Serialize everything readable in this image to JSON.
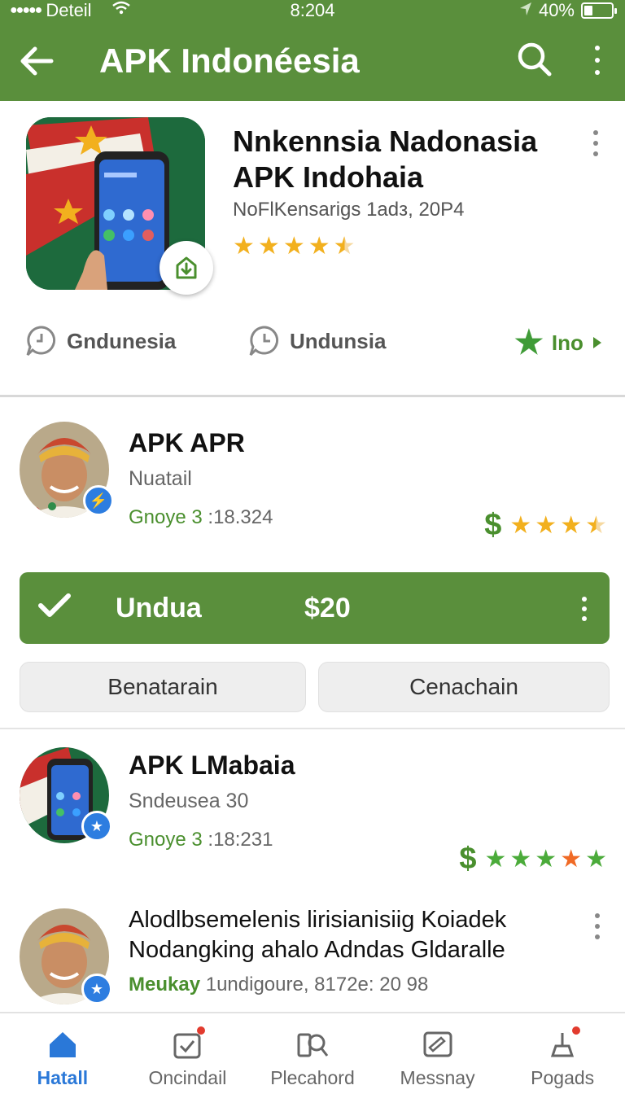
{
  "status_bar": {
    "dots": "●●●●●",
    "carrier": "Deteil",
    "time": "8:204",
    "battery": "40%"
  },
  "app_bar": {
    "title": "APK  Indonéesia"
  },
  "hero": {
    "title": "Nnkennsia Nadonasia APK Indohaia",
    "subtitle": "NoFlKensarigs 1adз, 20P4",
    "rating_stars": 4.5,
    "actions": [
      {
        "label": "Gndunesia"
      },
      {
        "label": "Undunsia"
      },
      {
        "label": "Ino"
      }
    ]
  },
  "items": [
    {
      "title": "APK APR",
      "subtitle": "Nuatail",
      "meta_green": "Gnoye 3",
      "meta_rest": " :18.324",
      "dollar": "$"
    },
    {
      "title": "APK LMabaia",
      "subtitle": "Sndeusea 30",
      "meta_green": "Gnoye 3",
      "meta_rest": " :18:231",
      "dollar": "$"
    },
    {
      "title": "Alodlbsemelenis lirisianisiig Koiadek Nodangking ahalo Adndas Gldaralle",
      "meta_green": "Meukay",
      "meta_rest": " 1undigoure, 8172e: 20 98"
    }
  ],
  "cta": {
    "label": "Undua",
    "price": "$20"
  },
  "secondary_buttons": {
    "left": "Benatarain",
    "right": "Cenachain"
  },
  "bottom_nav": [
    {
      "label": "Hatall",
      "icon": "home-icon",
      "active": true
    },
    {
      "label": "Oncindail",
      "icon": "check-badge-icon"
    },
    {
      "label": "Plecahord",
      "icon": "search-doc-icon"
    },
    {
      "label": "Messnay",
      "icon": "message-icon"
    },
    {
      "label": "Pogads",
      "icon": "profile-icon"
    }
  ],
  "colors": {
    "primary_green": "#5a8f3c",
    "accent_blue": "#2a78d8",
    "star_gold": "#f2b01e",
    "star_green": "#4bab3a"
  }
}
